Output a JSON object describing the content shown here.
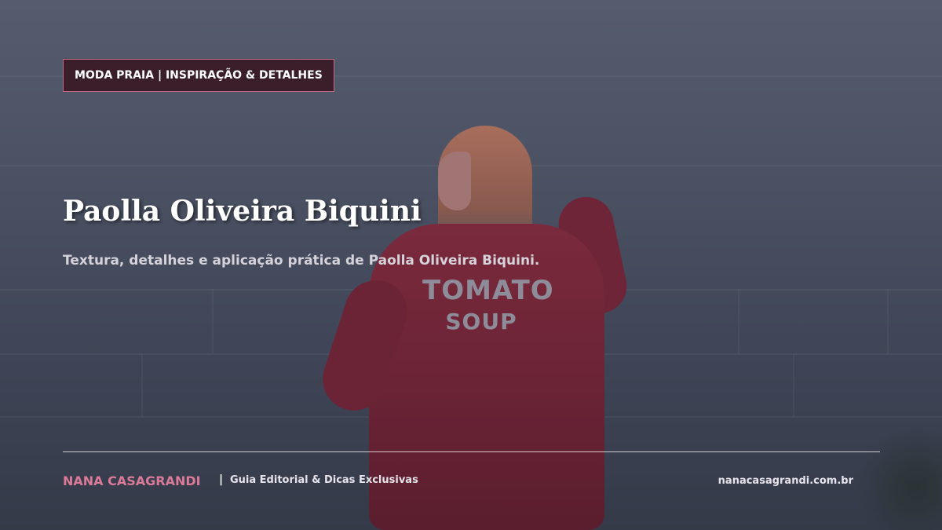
{
  "header": {
    "category_tag": "MODA PRAIA | INSPIRAÇÃO & DETALHES"
  },
  "hero": {
    "title": "Paolla Oliveira Biquini",
    "subtitle": "Textura, detalhes e aplicação prática de Paolla Oliveira Biquini.",
    "sweater_print": {
      "line1": "TOMATO",
      "line2": "SOUP"
    }
  },
  "footer": {
    "brand": "NANA CASAGRANDI",
    "separator": "|",
    "tagline": "Guia Editorial & Dicas Exclusivas",
    "website": "nanacasagrandi.com.br"
  },
  "colors": {
    "accent_pink": "#d97a99",
    "tag_background": "#3a1f2a",
    "tag_border": "#c06a86",
    "overlay": "#4a5162"
  }
}
